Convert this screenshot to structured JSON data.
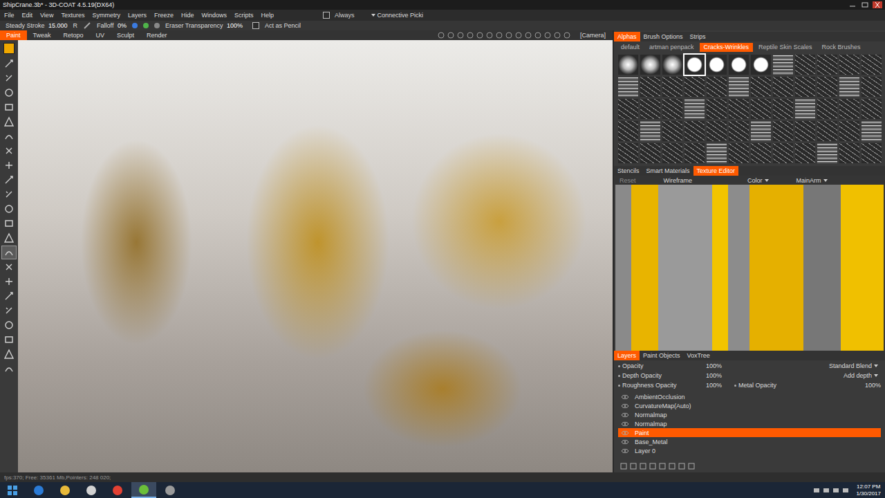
{
  "window": {
    "title": "ShipCrane.3b* - 3D-COAT 4.5.19(DX64)"
  },
  "menu": {
    "items": [
      "File",
      "Edit",
      "View",
      "Textures",
      "Symmetry",
      "Layers",
      "Freeze",
      "Hide",
      "Windows",
      "Scripts",
      "Help"
    ],
    "checkbox_checked": false,
    "always_label": "Always",
    "dropdown": "Connective Picki"
  },
  "toolbar": {
    "steady_label": "Steady Stroke",
    "steady_value": "15.000",
    "r_label": "R",
    "falloff_label": "Falloff",
    "falloff_value": "0%",
    "eraser_label": "Eraser Transparency",
    "eraser_value": "100%",
    "pencil_label": "Act as Pencil",
    "pencil_checked": false
  },
  "mode_tabs": [
    {
      "label": "Paint",
      "selected": true
    },
    {
      "label": "Tweak",
      "selected": false
    },
    {
      "label": "Retopo",
      "selected": false
    },
    {
      "label": "UV",
      "selected": false
    },
    {
      "label": "Sculpt",
      "selected": false
    },
    {
      "label": "Render",
      "selected": false
    }
  ],
  "camera_label": "[Camera]",
  "color_swatch": "#f0a800",
  "tools": [
    {
      "selected": false
    },
    {
      "selected": false
    },
    {
      "selected": false
    },
    {
      "selected": false
    },
    {
      "selected": false
    },
    {
      "selected": false
    },
    {
      "selected": false
    },
    {
      "selected": false
    },
    {
      "selected": false
    },
    {
      "selected": false
    },
    {
      "selected": false
    },
    {
      "selected": false
    },
    {
      "selected": false
    },
    {
      "selected": true
    },
    {
      "selected": false
    },
    {
      "selected": false
    },
    {
      "selected": false
    },
    {
      "selected": false
    },
    {
      "selected": false
    },
    {
      "selected": false
    },
    {
      "selected": false
    },
    {
      "selected": false
    }
  ],
  "brush_panel": {
    "tabs": [
      {
        "label": "Alphas",
        "selected": true
      },
      {
        "label": "Brush Options",
        "selected": false
      },
      {
        "label": "Strips",
        "selected": false
      }
    ],
    "sets": [
      {
        "label": "default",
        "selected": false
      },
      {
        "label": "artman penpack",
        "selected": false
      },
      {
        "label": "Cracks-Wrinkles",
        "selected": true
      },
      {
        "label": "Reptile Skin Scales",
        "selected": false
      },
      {
        "label": "Rock Brushes",
        "selected": false
      }
    ],
    "alphas": [
      {
        "selected": false
      },
      {
        "selected": false
      },
      {
        "selected": false
      },
      {
        "selected": true
      },
      {
        "selected": false
      },
      {
        "selected": false
      },
      {
        "selected": false
      },
      {
        "selected": false
      },
      {
        "selected": false
      },
      {
        "selected": false
      },
      {
        "selected": false
      },
      {
        "selected": false
      },
      {
        "selected": false
      },
      {
        "selected": false
      },
      {
        "selected": false
      },
      {
        "selected": false
      },
      {
        "selected": false
      },
      {
        "selected": false
      },
      {
        "selected": false
      },
      {
        "selected": false
      },
      {
        "selected": false
      },
      {
        "selected": false
      },
      {
        "selected": false
      },
      {
        "selected": false
      },
      {
        "selected": false
      },
      {
        "selected": false
      },
      {
        "selected": false
      },
      {
        "selected": false
      },
      {
        "selected": false
      },
      {
        "selected": false
      },
      {
        "selected": false
      },
      {
        "selected": false
      },
      {
        "selected": false
      },
      {
        "selected": false
      },
      {
        "selected": false
      },
      {
        "selected": false
      },
      {
        "selected": false
      },
      {
        "selected": false
      },
      {
        "selected": false
      },
      {
        "selected": false
      },
      {
        "selected": false
      },
      {
        "selected": false
      },
      {
        "selected": false
      },
      {
        "selected": false
      },
      {
        "selected": false
      },
      {
        "selected": false
      },
      {
        "selected": false
      },
      {
        "selected": false
      },
      {
        "selected": false
      },
      {
        "selected": false
      },
      {
        "selected": false
      },
      {
        "selected": false
      },
      {
        "selected": false
      },
      {
        "selected": false
      },
      {
        "selected": false
      },
      {
        "selected": false
      },
      {
        "selected": false
      },
      {
        "selected": false
      },
      {
        "selected": false
      },
      {
        "selected": false
      }
    ]
  },
  "texture_panel": {
    "tabs": [
      {
        "label": "Stencils",
        "selected": false
      },
      {
        "label": "Smart Materials",
        "selected": false
      },
      {
        "label": "Texture Editor",
        "selected": true
      }
    ],
    "reset_label": "Reset",
    "reset_disabled": true,
    "wireframe_label": "Wireframe",
    "channel": "Color",
    "object": "MainArm"
  },
  "layers_panel": {
    "tabs": [
      {
        "label": "Layers",
        "selected": true
      },
      {
        "label": "Paint Objects",
        "selected": false
      },
      {
        "label": "VoxTree",
        "selected": false
      }
    ],
    "properties": [
      {
        "kind": "select",
        "label": "Opacity",
        "value": "100%",
        "extra": "Standard Blend",
        "extra_value": ""
      },
      {
        "kind": "select",
        "label": "Depth Opacity",
        "value": "100%",
        "extra": "Add depth",
        "extra_value": ""
      },
      {
        "kind": "pair",
        "label": "Roughness Opacity",
        "value": "100%",
        "extra": "Metal Opacity",
        "extra_value": "100%"
      }
    ],
    "layers": [
      {
        "name": "AmbientOcclusion",
        "selected": false,
        "visible": true
      },
      {
        "name": "CurvatureMap(Auto)",
        "selected": false,
        "visible": true
      },
      {
        "name": "Normalmap",
        "selected": false,
        "visible": true
      },
      {
        "name": "Normalmap",
        "selected": false,
        "visible": true
      },
      {
        "name": "Paint",
        "selected": true,
        "visible": true
      },
      {
        "name": "Base_Metal",
        "selected": false,
        "visible": true
      },
      {
        "name": "Layer 0",
        "selected": false,
        "visible": true
      }
    ]
  },
  "status_bar": {
    "text": "fps:370;  Free: 35361 Mb,Pointers: 248 020;"
  },
  "taskbar": {
    "apps": [
      {
        "active": false
      },
      {
        "active": false
      },
      {
        "active": false
      },
      {
        "active": false
      },
      {
        "active": true
      },
      {
        "active": false
      }
    ],
    "time": "12:07 PM",
    "date": "1/30/2017"
  }
}
